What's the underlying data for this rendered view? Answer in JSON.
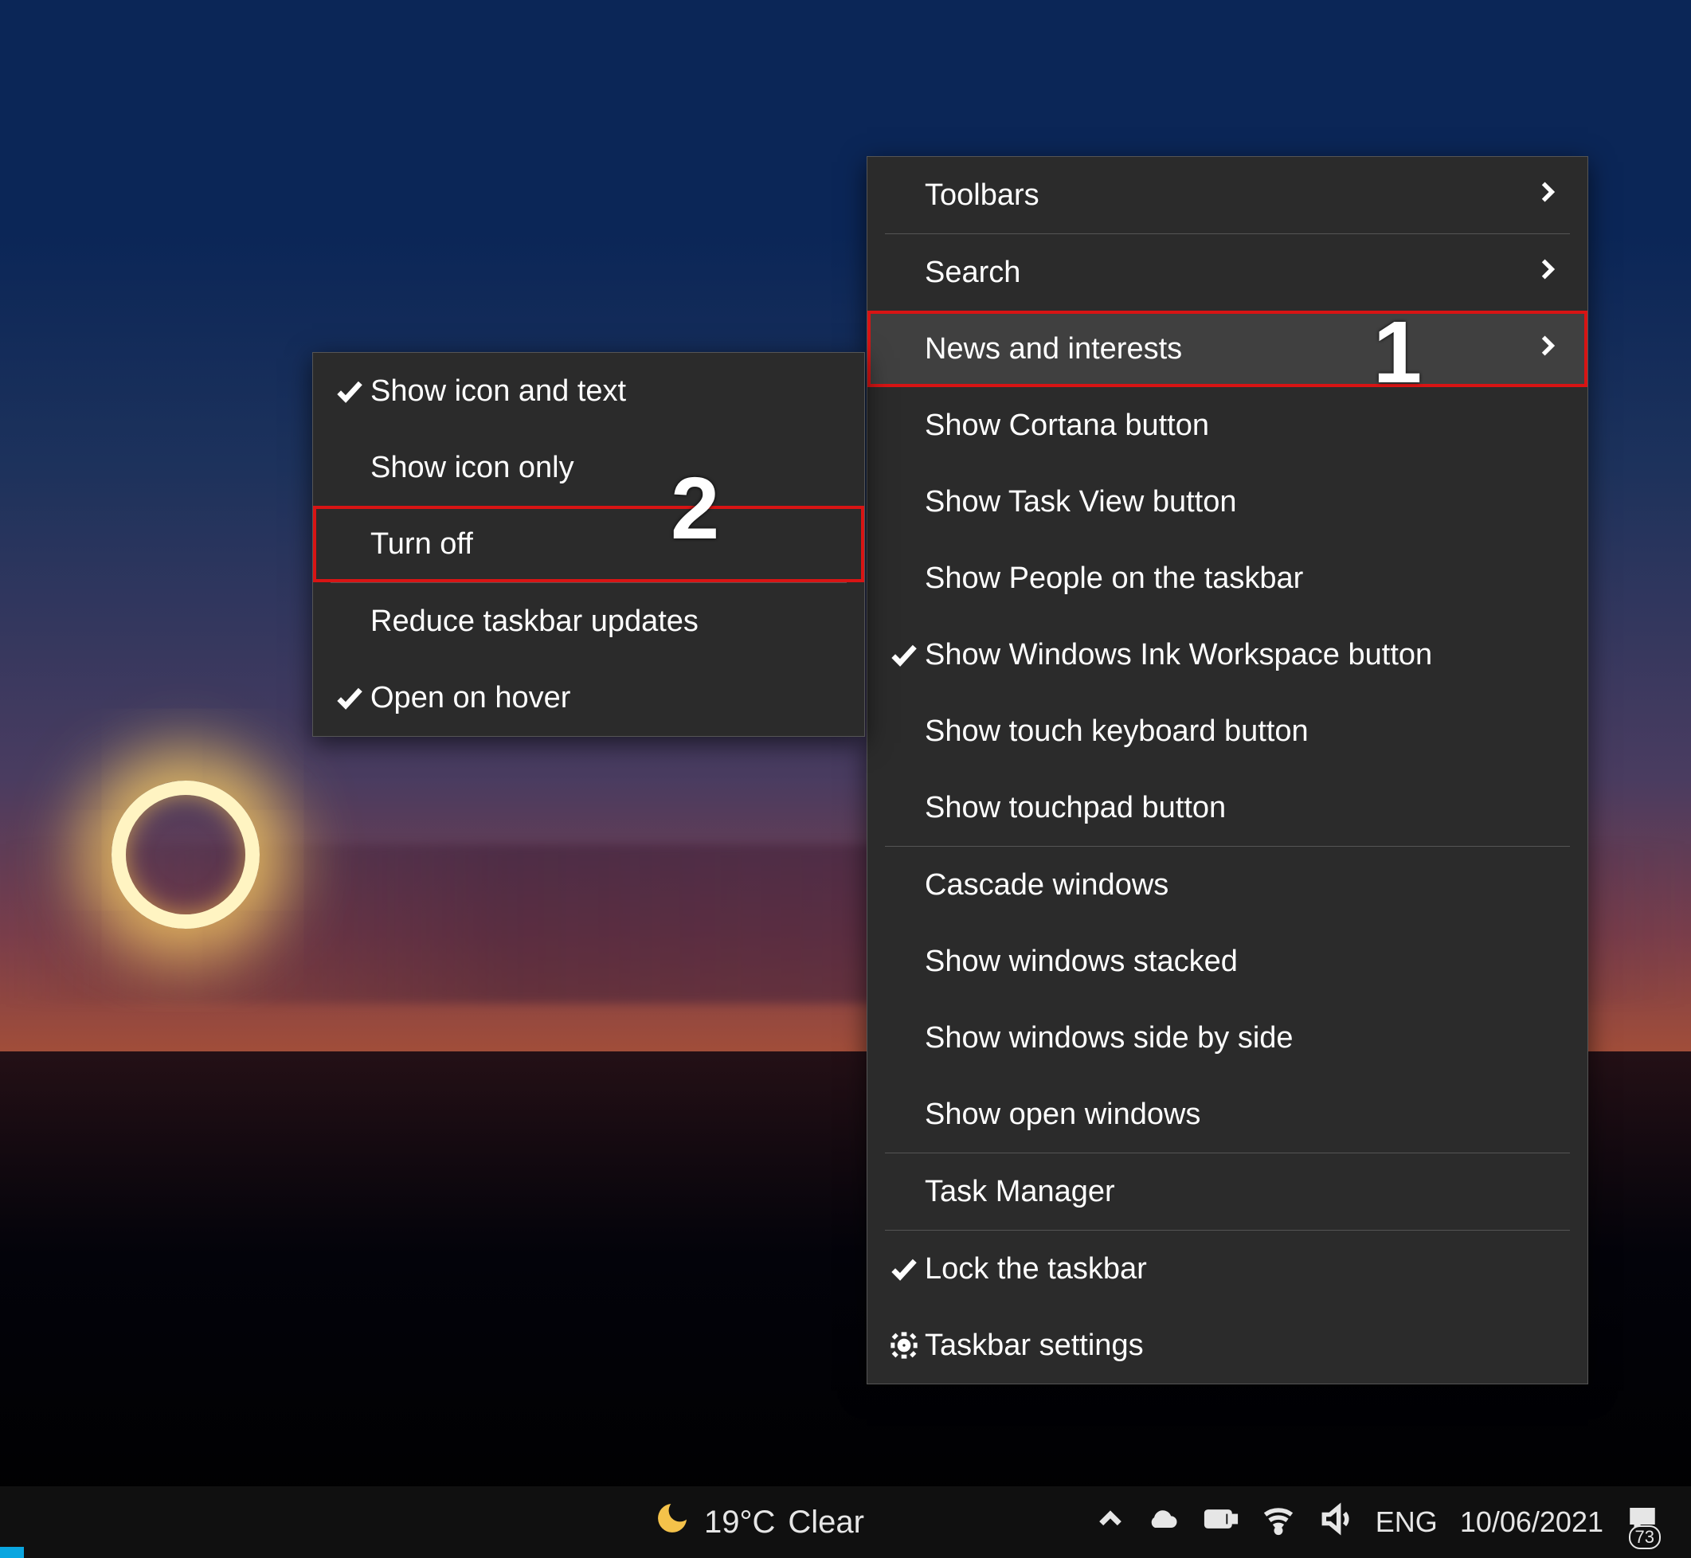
{
  "desktop": {
    "wallpaper_description": "Solar eclipse at sunset over horizon"
  },
  "taskbar": {
    "weather_temp": "19°C",
    "weather_label": "Clear",
    "language": "ENG",
    "date": "10/06/2021",
    "notification_count": "73"
  },
  "main_menu": {
    "groups": [
      {
        "items": [
          {
            "id": "toolbars",
            "label": "Toolbars",
            "submenu": true
          }
        ]
      },
      {
        "items": [
          {
            "id": "search",
            "label": "Search",
            "submenu": true
          },
          {
            "id": "news-interests",
            "label": "News and interests",
            "submenu": true,
            "highlighted": true
          },
          {
            "id": "cortana",
            "label": "Show Cortana button"
          },
          {
            "id": "taskview",
            "label": "Show Task View button"
          },
          {
            "id": "people",
            "label": "Show People on the taskbar"
          },
          {
            "id": "ink",
            "label": "Show Windows Ink Workspace button",
            "checked": true
          },
          {
            "id": "touchkb",
            "label": "Show touch keyboard button"
          },
          {
            "id": "touchpad",
            "label": "Show touchpad button"
          }
        ]
      },
      {
        "items": [
          {
            "id": "cascade",
            "label": "Cascade windows"
          },
          {
            "id": "stacked",
            "label": "Show windows stacked"
          },
          {
            "id": "sidebyside",
            "label": "Show windows side by side"
          },
          {
            "id": "open",
            "label": "Show open windows"
          }
        ]
      },
      {
        "items": [
          {
            "id": "taskmgr",
            "label": "Task Manager"
          }
        ]
      },
      {
        "items": [
          {
            "id": "lock",
            "label": "Lock the taskbar",
            "checked": true
          },
          {
            "id": "settings",
            "label": "Taskbar settings",
            "gear": true
          }
        ]
      }
    ]
  },
  "sub_menu": {
    "items": [
      {
        "id": "icon-text",
        "label": "Show icon and text",
        "checked": true
      },
      {
        "id": "icon-only",
        "label": "Show icon only"
      },
      {
        "id": "turn-off",
        "label": "Turn off",
        "highlighted": true
      },
      {
        "sep": true
      },
      {
        "id": "reduce",
        "label": "Reduce taskbar updates"
      },
      {
        "id": "hover",
        "label": "Open on hover",
        "checked": true
      }
    ]
  },
  "annotations": {
    "n1": "1",
    "n2": "2"
  }
}
